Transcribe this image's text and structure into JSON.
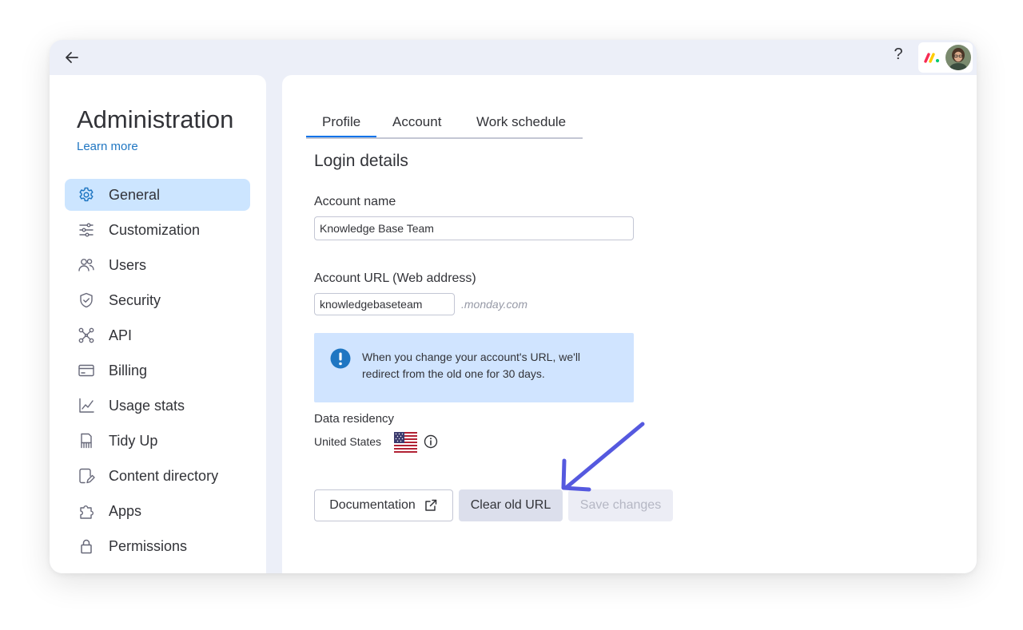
{
  "topbar": {
    "back_icon": "arrow-left-icon",
    "help_label": "?",
    "logo_icon": "monday-logo-icon",
    "avatar_icon": "user-avatar"
  },
  "sidebar": {
    "title": "Administration",
    "learn_more": "Learn more",
    "items": [
      {
        "label": "General",
        "icon": "gear-icon",
        "active": true
      },
      {
        "label": "Customization",
        "icon": "sliders-icon"
      },
      {
        "label": "Users",
        "icon": "users-icon"
      },
      {
        "label": "Security",
        "icon": "shield-icon"
      },
      {
        "label": "API",
        "icon": "api-icon"
      },
      {
        "label": "Billing",
        "icon": "credit-card-icon"
      },
      {
        "label": "Usage stats",
        "icon": "chart-icon"
      },
      {
        "label": "Tidy Up",
        "icon": "broom-icon"
      },
      {
        "label": "Content directory",
        "icon": "content-icon"
      },
      {
        "label": "Apps",
        "icon": "puzzle-icon"
      },
      {
        "label": "Permissions",
        "icon": "lock-icon"
      }
    ]
  },
  "tabs": [
    {
      "label": "Profile",
      "active": true
    },
    {
      "label": "Account"
    },
    {
      "label": "Work schedule"
    }
  ],
  "main": {
    "section_title": "Login details",
    "account_name_label": "Account name",
    "account_name_value": "Knowledge Base Team",
    "account_url_label": "Account URL (Web address)",
    "account_url_value": "knowledgebaseteam",
    "account_url_suffix": ".monday.com",
    "info_text": "When you change your account's URL, we'll redirect from the old one for 30 days.",
    "data_residency_label": "Data residency",
    "data_residency_value": "United States",
    "flag_icon": "us-flag-icon"
  },
  "buttons": {
    "documentation": "Documentation",
    "clear_old_url": "Clear old URL",
    "save_changes": "Save changes"
  },
  "colors": {
    "accent": "#0073ea",
    "active_nav": "#cce5ff",
    "info_box": "#d0e4ff",
    "annotation_arrow": "#5559df"
  }
}
